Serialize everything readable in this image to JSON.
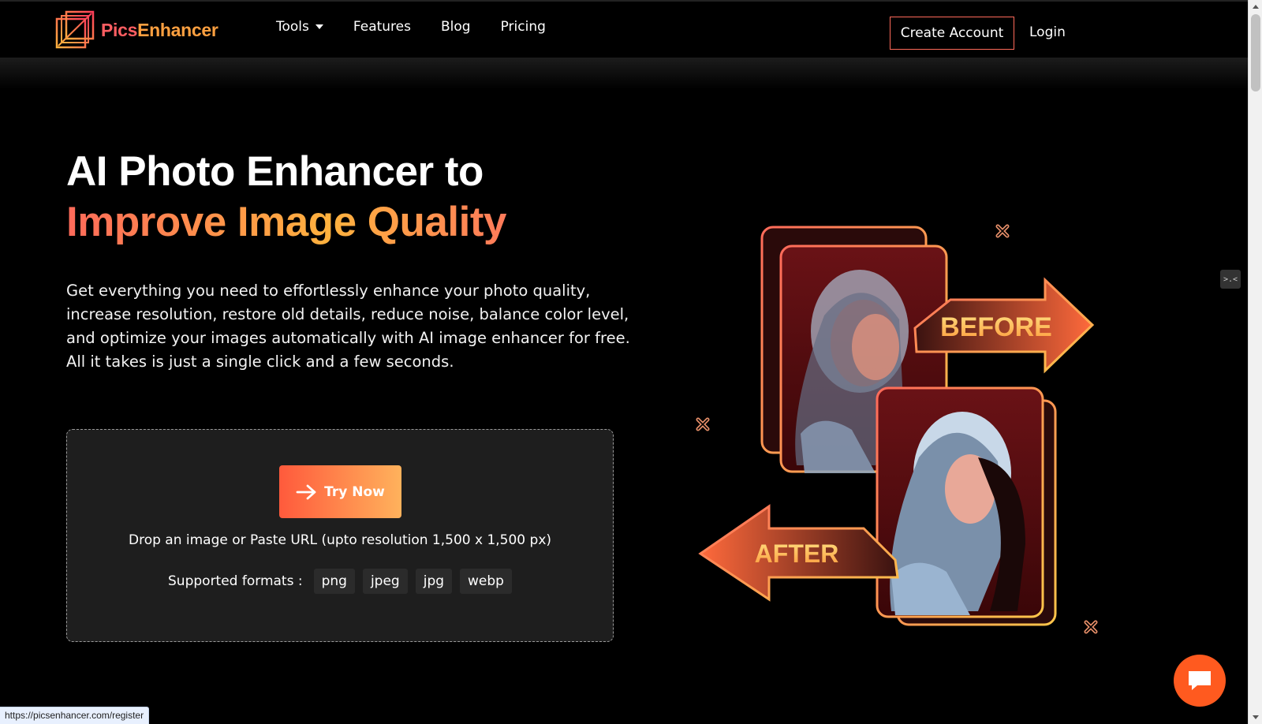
{
  "header": {
    "logo_text_a": "Pics",
    "logo_text_b": "Enhancer",
    "nav": [
      {
        "label": "Tools"
      },
      {
        "label": "Features"
      },
      {
        "label": "Blog"
      },
      {
        "label": "Pricing"
      }
    ],
    "create_account_label": "Create Account",
    "login_label": "Login"
  },
  "hero": {
    "title_line1": "AI Photo Enhancer to",
    "title_line2": "Improve Image Quality",
    "description": "Get everything you need to effortlessly enhance your photo quality, increase resolution, restore old details, reduce noise, balance color level, and optimize your images automatically with AI image enhancer for free. All it takes is just a single click and a few seconds."
  },
  "upload": {
    "try_now_label": "Try Now",
    "drop_text": "Drop an image or Paste URL (upto resolution 1,500 x 1,500 px)",
    "formats_label": "Supported formats :",
    "formats": [
      "png",
      "jpeg",
      "jpg",
      "webp"
    ]
  },
  "illustration": {
    "before_label": "BEFORE",
    "after_label": "AFTER"
  },
  "status_bar": {
    "url": "https://picsenhancer.com/register"
  },
  "colors": {
    "accent_red": "#ff5e62",
    "accent_orange": "#ffa040",
    "background": "#000000",
    "chat_button": "#ff5a1f"
  }
}
